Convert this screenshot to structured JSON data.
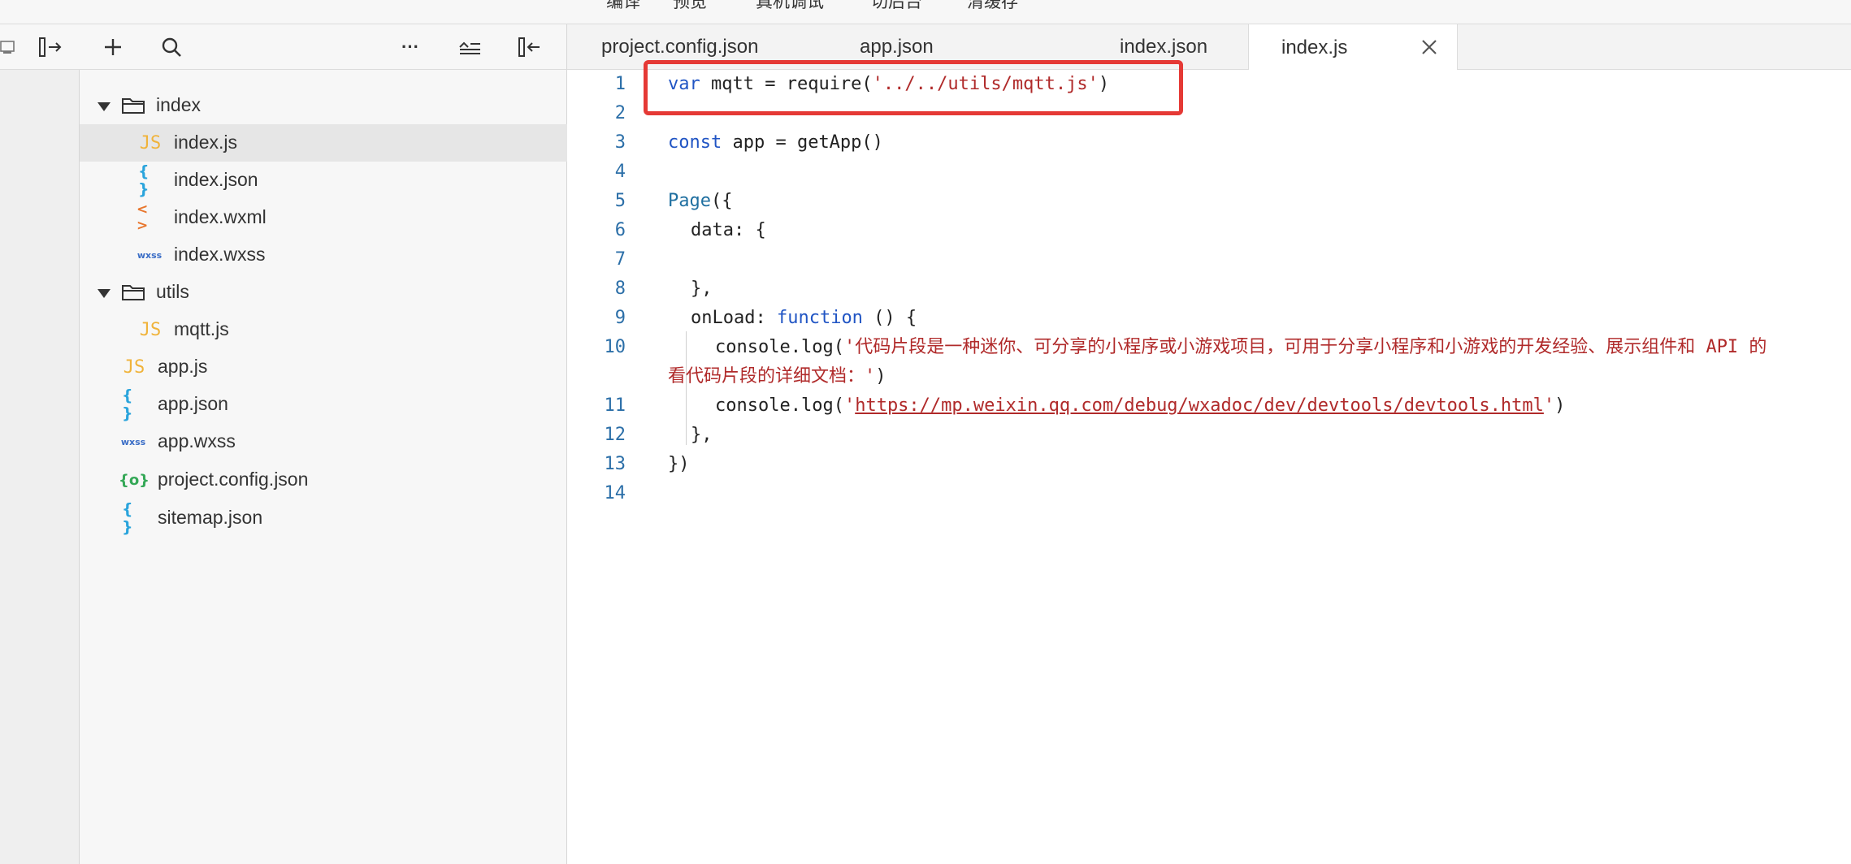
{
  "topbar": {
    "items": [
      "编译",
      "预览",
      "真机调试",
      "切后台",
      "清缓存"
    ]
  },
  "toolbar": {
    "icons": [
      "collapse-panel-icon",
      "split-right-icon",
      "add-icon",
      "search-icon",
      "more-icon",
      "collapse-all-icon",
      "split-left-icon"
    ],
    "more_label": "···"
  },
  "filetree": {
    "items": [
      {
        "label": "index",
        "type": "folder",
        "icon": "folder-icon"
      },
      {
        "label": "index.js",
        "type": "js",
        "icon": "js-file-icon"
      },
      {
        "label": "index.json",
        "type": "json",
        "icon": "json-file-icon"
      },
      {
        "label": "index.wxml",
        "type": "wxml",
        "icon": "wxml-file-icon"
      },
      {
        "label": "index.wxss",
        "type": "wxss",
        "icon": "wxss-file-icon"
      },
      {
        "label": "utils",
        "type": "folder",
        "icon": "folder-icon"
      },
      {
        "label": "mqtt.js",
        "type": "js",
        "icon": "js-file-icon"
      },
      {
        "label": "app.js",
        "type": "js",
        "icon": "js-file-icon"
      },
      {
        "label": "app.json",
        "type": "json",
        "icon": "json-file-icon"
      },
      {
        "label": "app.wxss",
        "type": "wxss",
        "icon": "wxss-file-icon"
      },
      {
        "label": "project.config.json",
        "type": "config",
        "icon": "config-file-icon"
      },
      {
        "label": "sitemap.json",
        "type": "json",
        "icon": "json-file-icon"
      }
    ],
    "icon_glyphs": {
      "js": "JS",
      "json": "{ }",
      "wxml": "< >",
      "wxss": "wxss",
      "config": "{o}"
    }
  },
  "tabs": [
    {
      "label": "project.config.json",
      "active": false
    },
    {
      "label": "app.json",
      "active": false
    },
    {
      "label": "index.json",
      "active": false
    },
    {
      "label": "index.js",
      "active": true
    }
  ],
  "editor": {
    "line_numbers": [
      "1",
      "2",
      "3",
      "4",
      "5",
      "6",
      "7",
      "8",
      "9",
      "10",
      "11",
      "12",
      "13",
      "14"
    ],
    "lines": {
      "l1_kw": "var",
      "l1_a": " mqtt = require(",
      "l1_str": "'../../utils/mqtt.js'",
      "l1_b": ")",
      "l3_kw": "const",
      "l3_a": " app = getApp()",
      "l5_fn": "Page",
      "l5_a": "({",
      "l6": "data: {",
      "l8": "},",
      "l9_a": "onLoad: ",
      "l9_kw": "function",
      "l9_b": " () {",
      "l10_a": "console.log(",
      "l10_str": "'代码片段是一种迷你、可分享的小程序或小游戏项目，可用于分享小程序和小游戏的开发经验、展示组件和 API 的",
      "l10_wrap_str": "看代码片段的详细文档：'",
      "l10_wrap_b": ")",
      "l11_a": "console.log(",
      "l11_q1": "'",
      "l11_url": "https://mp.weixin.qq.com/debug/wxadoc/dev/devtools/devtools.html",
      "l11_q2": "'",
      "l11_b": ")",
      "l12": "},",
      "l13": "})"
    }
  },
  "colors": {
    "highlight_box": "#e53935",
    "keyword": "#2155c4",
    "string": "#b02a2a",
    "line_number": "#2c6fa8",
    "js_icon": "#f0b33a",
    "json_icon": "#2aa4dc",
    "wxml_icon": "#e8762d",
    "wxss_icon": "#3a6dc6",
    "config_icon": "#35a857"
  }
}
